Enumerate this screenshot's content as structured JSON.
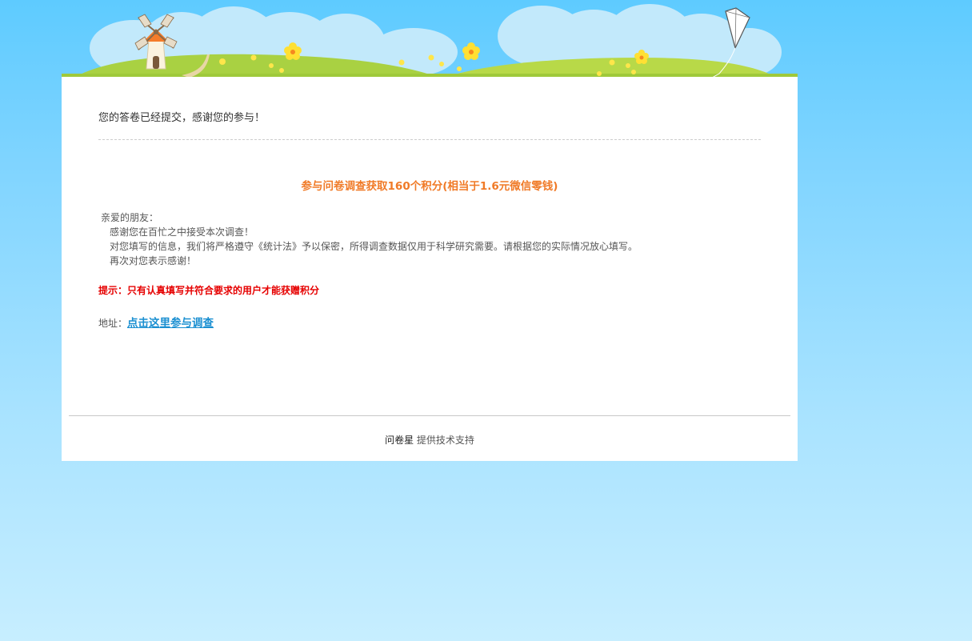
{
  "message": {
    "thanks": "您的答卷已经提交，感谢您的参与！"
  },
  "promo": {
    "headline": "参与问卷调查获取160个积分(相当于1.6元微信零钱)"
  },
  "letter": {
    "greeting": "亲爱的朋友：",
    "lines": [
      "感谢您在百忙之中接受本次调查！",
      "对您填写的信息，我们将严格遵守《统计法》予以保密，所得调查数据仅用于科学研究需要。请根据您的实际情况放心填写。",
      "再次对您表示感谢！"
    ]
  },
  "tip": "提示：只有认真填写并符合要求的用户才能获赠积分",
  "address": {
    "label": "地址：",
    "link_text": "点击这里参与调查"
  },
  "footer": {
    "brand": "问卷星",
    "text": " 提供技术支持"
  },
  "colors": {
    "sky_top": "#5ecbff",
    "sky_bottom": "#c7eeff",
    "headline": "#f07a27",
    "tip": "#e60000",
    "link": "#1a8fd1"
  },
  "icons": {
    "windmill": "windmill-icon",
    "kite": "kite-icon",
    "flower": "flower-icon"
  }
}
